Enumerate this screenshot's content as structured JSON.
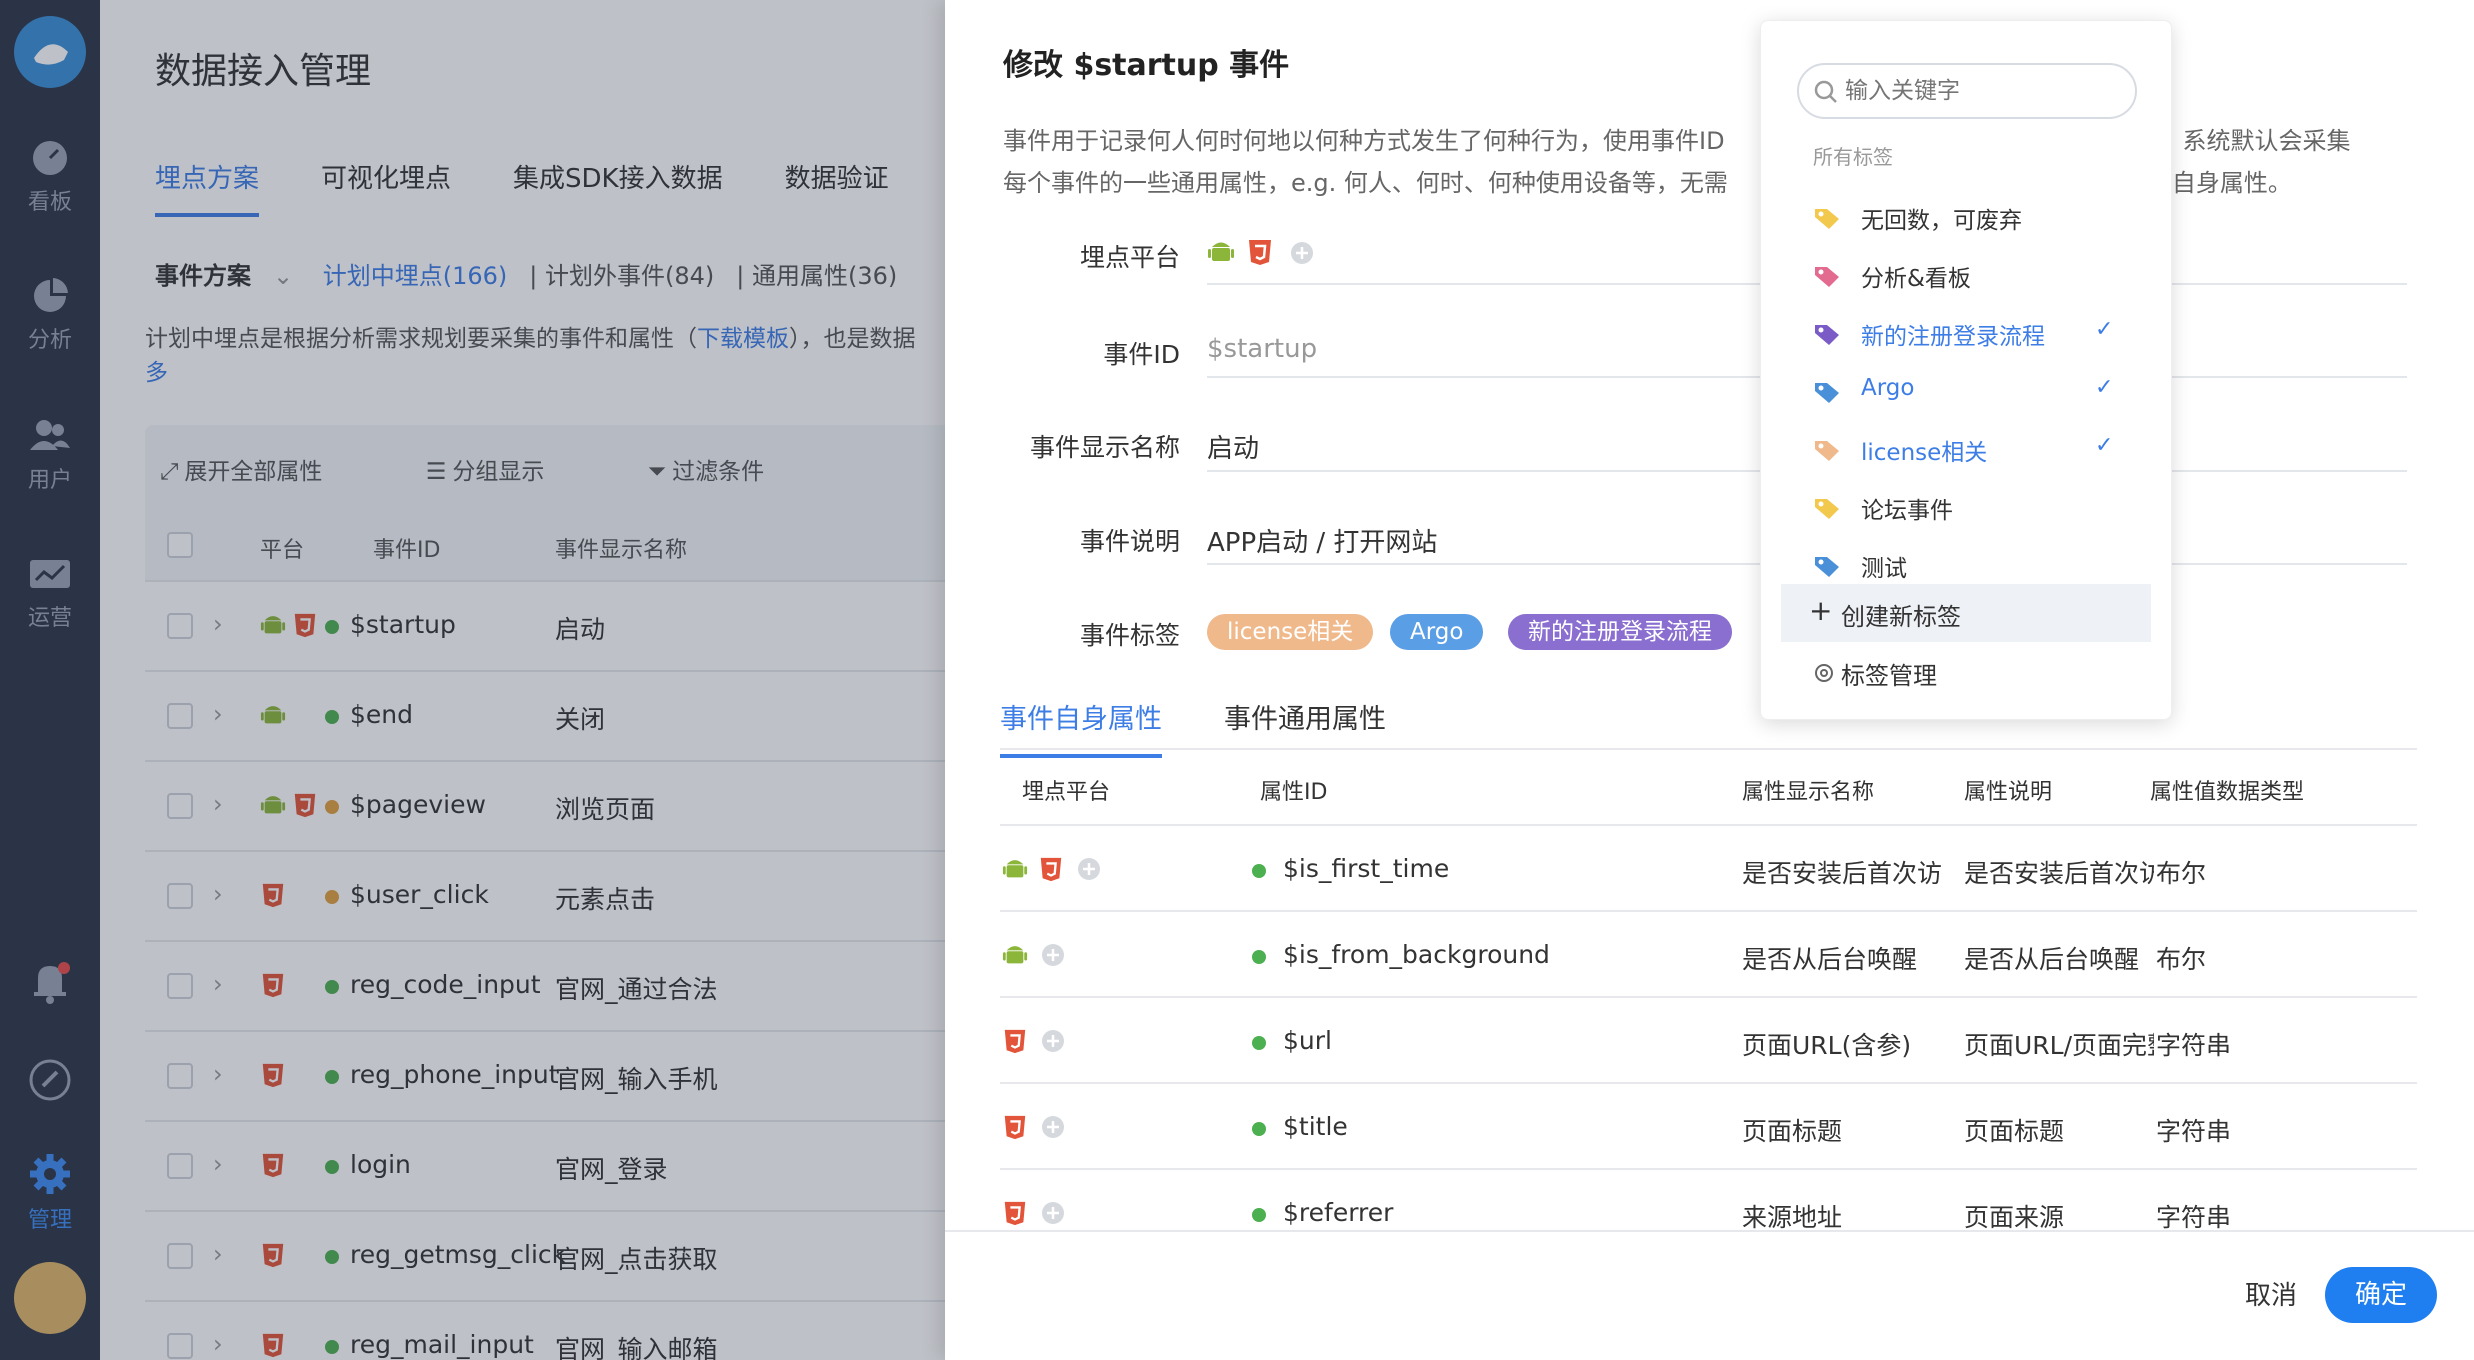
{
  "nav": {
    "items": [
      {
        "label": "看板"
      },
      {
        "label": "分析"
      },
      {
        "label": "用户"
      },
      {
        "label": "运营"
      },
      {
        "label": "管理"
      }
    ]
  },
  "page": {
    "title": "数据接入管理",
    "tabs": [
      "埋点方案",
      "可视化埋点",
      "集成SDK接入数据",
      "数据验证"
    ],
    "subtabs": {
      "scheme": "事件方案",
      "planned": "计划中埋点(166)",
      "unplanned": "计划外事件(84)",
      "common": "通用属性(36)"
    },
    "desc_pre": "计划中埋点是根据分析需求规划要采集的事件和属性（",
    "desc_link": "下载模板",
    "desc_post": "），也是数据",
    "desc_more": "多",
    "tools": {
      "expand": "展开全部属性",
      "group": "分组显示",
      "filter": "过滤条件"
    },
    "columns": {
      "platform": "平台",
      "event_id": "事件ID",
      "event_name": "事件显示名称"
    },
    "rows": [
      {
        "id": "$startup",
        "name": "启动",
        "status": "#4caf50",
        "platforms": [
          "android",
          "html5"
        ]
      },
      {
        "id": "$end",
        "name": "关闭",
        "status": "#4caf50",
        "platforms": [
          "android"
        ]
      },
      {
        "id": "$pageview",
        "name": "浏览页面",
        "status": "#e0a040",
        "platforms": [
          "android",
          "html5"
        ]
      },
      {
        "id": "$user_click",
        "name": "元素点击",
        "status": "#e0a040",
        "platforms": [
          "html5"
        ]
      },
      {
        "id": "reg_code_input",
        "name": "官网_通过合法",
        "status": "#4caf50",
        "platforms": [
          "html5"
        ]
      },
      {
        "id": "reg_phone_input",
        "name": "官网_输入手机",
        "status": "#4caf50",
        "platforms": [
          "html5"
        ]
      },
      {
        "id": "login",
        "name": "官网_登录",
        "status": "#4caf50",
        "platforms": [
          "html5"
        ]
      },
      {
        "id": "reg_getmsg_click",
        "name": "官网_点击获取",
        "status": "#4caf50",
        "platforms": [
          "html5"
        ]
      },
      {
        "id": "reg_mail_input",
        "name": "官网_输入邮箱",
        "status": "#4caf50",
        "platforms": [
          "html5"
        ]
      }
    ]
  },
  "drawer": {
    "title": "修改 $startup 事件",
    "desc_line1": "事件用于记录何人何时何地以何种方式发生了何种行为，使用事件ID",
    "desc_line1_tail": "息。系统默认会采集",
    "desc_line2": "每个事件的一些通用属性，e.g. 何人、何时、何种使用设备等，无需",
    "desc_line2_tail": "事件自身属性。",
    "fields": {
      "platform_label": "埋点平台",
      "event_id_label": "事件ID",
      "event_id_value": "$startup",
      "display_name_label": "事件显示名称",
      "display_name_value": "启动",
      "description_label": "事件说明",
      "description_value": "APP启动 / 打开网站",
      "tags_label": "事件标签"
    },
    "tags": [
      {
        "label": "license相关",
        "color": "#f0b98c"
      },
      {
        "label": "Argo",
        "color": "#5a9ee6"
      },
      {
        "label": "新的注册登录流程",
        "color": "#8a6fd0"
      }
    ],
    "tabs": [
      "事件自身属性",
      "事件通用属性"
    ],
    "prop_columns": {
      "platform": "埋点平台",
      "id": "属性ID",
      "name": "属性显示名称",
      "desc": "属性说明",
      "type": "属性值数据类型"
    },
    "props": [
      {
        "id": "$is_first_time",
        "name": "是否安装后首次访问",
        "desc": "是否安装后首次访问",
        "type": "布尔",
        "platforms": [
          "android",
          "html5"
        ]
      },
      {
        "id": "$is_from_background",
        "name": "是否从后台唤醒",
        "desc": "是否从后台唤醒",
        "type": "布尔",
        "platforms": [
          "android"
        ]
      },
      {
        "id": "$url",
        "name": "页面URL(含参)",
        "desc": "页面URL/页面完整",
        "type": "字符串",
        "platforms": [
          "html5"
        ]
      },
      {
        "id": "$title",
        "name": "页面标题",
        "desc": "页面标题",
        "type": "字符串",
        "platforms": [
          "html5"
        ]
      },
      {
        "id": "$referrer",
        "name": "来源地址",
        "desc": "页面来源",
        "type": "字符串",
        "platforms": [
          "html5"
        ]
      }
    ],
    "cancel": "取消",
    "confirm": "确定"
  },
  "tag_dropdown": {
    "search_placeholder": "输入关键字",
    "heading": "所有标签",
    "items": [
      {
        "label": "无回数，可废弃",
        "color": "#f2c94c",
        "selected": false
      },
      {
        "label": "分析&看板",
        "color": "#e36b8f",
        "selected": false
      },
      {
        "label": "新的注册登录流程",
        "color": "#7b5cc7",
        "selected": true
      },
      {
        "label": "Argo",
        "color": "#4a90d9",
        "selected": true
      },
      {
        "label": "license相关",
        "color": "#f0b98c",
        "selected": true
      },
      {
        "label": "论坛事件",
        "color": "#f2c94c",
        "selected": false
      },
      {
        "label": "测试",
        "color": "#4a90d9",
        "selected": false
      }
    ],
    "create": "创建新标签",
    "manage": "标签管理"
  }
}
